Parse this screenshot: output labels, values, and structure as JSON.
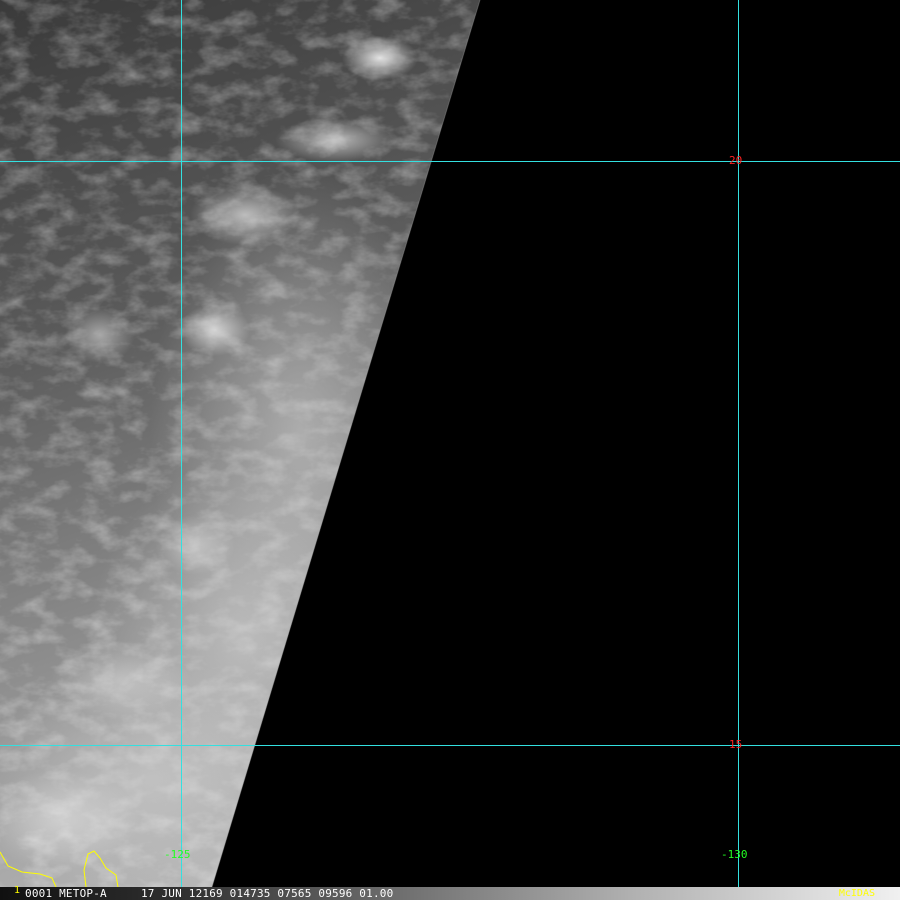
{
  "image": {
    "description_colors": {
      "grid": "#33e0e0",
      "lat_label": "#ff2020",
      "lon_label": "#22ff22",
      "coastline": "#ffff00",
      "no_data": "#000000"
    }
  },
  "grid_labels": {
    "lat_20": "20",
    "lat_15": "15",
    "lon_125": "-125",
    "lon_130": "-130"
  },
  "info_bar": {
    "frame_number": "1",
    "text": "0001 METOP-A     17 JUN 12169 014735 07565 09596 01.00",
    "logo": "McIDAS"
  }
}
